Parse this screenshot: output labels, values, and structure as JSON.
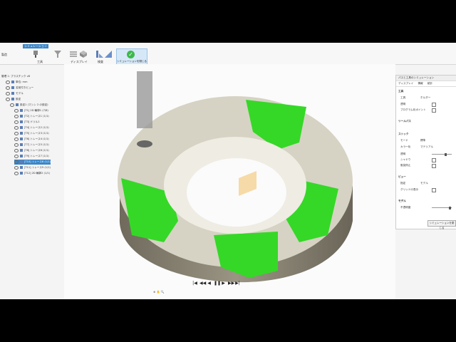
{
  "toolbar": {
    "workspace_label": "製造",
    "tab_label": "シミュレーション",
    "tool_label": "工具",
    "display_label": "ディスプレイ",
    "check_label": "検査",
    "sim_button_label": "シミュレーションを閉じる"
  },
  "browser": {
    "root_label": "管理 1: プラスチック v8",
    "items": [
      {
        "label": "単位: mm",
        "indent": 1
      },
      {
        "label": "名前付きビュー",
        "indent": 1
      },
      {
        "label": "モデル",
        "indent": 1
      },
      {
        "label": "設定",
        "indent": 1
      },
      {
        "label": "設定1 (マシン 2 の設定)",
        "indent": 2,
        "selected": false
      },
      {
        "label": "[T1] 2D 輪郭1 (7/8)",
        "indent": 3
      },
      {
        "label": "[T2] トレース1 (1/1)",
        "indent": 3
      },
      {
        "label": "[T3] ドリル1",
        "indent": 3
      },
      {
        "label": "[T4] トレース2 (1/1)",
        "indent": 3
      },
      {
        "label": "[T5] トレース3 (1/1)",
        "indent": 3
      },
      {
        "label": "[T6] トレース4 (1/1)",
        "indent": 3
      },
      {
        "label": "[T7] トレース5 (1/1)",
        "indent": 3
      },
      {
        "label": "[T8] トレース6 (1/1)",
        "indent": 3
      },
      {
        "label": "[T9] トレース7 (1/1)",
        "indent": 3
      },
      {
        "label": "[T10] トレース8 (1/1)",
        "indent": 3,
        "selected": true
      },
      {
        "label": "[T11] トレース9 (1/1)",
        "indent": 3
      },
      {
        "label": "[T12] 2D 輪郭2 (1/1)",
        "indent": 3
      }
    ]
  },
  "panel": {
    "title": "パスと工具のシミュレーション",
    "tabs": [
      "ディスプレイ",
      "情報",
      "統計"
    ],
    "section_tool": "工具",
    "tool_row_label": "工具",
    "tool_row_value": "ホルダー",
    "transparent_label": "透明",
    "show_holder_label": "プログラム化ポイント",
    "section_toolpath": "ツールパス",
    "section_stock": "ストック",
    "mode_label": "モード",
    "mode_value": "標準",
    "color_label": "カラー化",
    "color_value": "マテリアル",
    "opacity_label": "透明",
    "shadow_label": "シャドウ",
    "collision_label": "衝突停止",
    "section_view": "ビュー",
    "view_label": "指定",
    "view_value": "モデル",
    "grid_label": "グリッドの表示",
    "section_model": "モデル",
    "opacity2_label": "不透明度",
    "close_label": "シミュレーションを閉じる"
  },
  "playback": {
    "buttons": [
      "|◀",
      "◀◀",
      "◀",
      "❚❚",
      "▶",
      "▶▶",
      "▶|"
    ]
  }
}
